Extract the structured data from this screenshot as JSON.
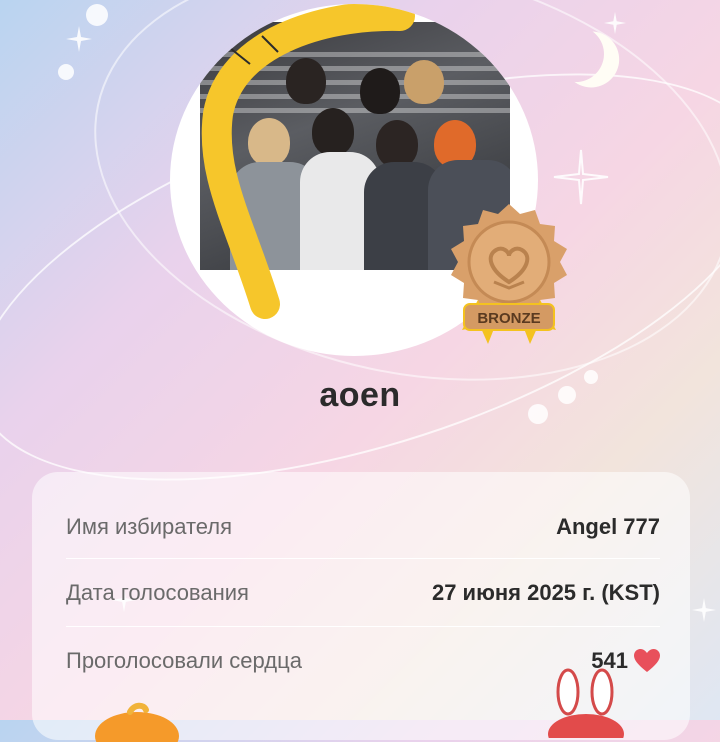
{
  "profile": {
    "username": "aoen",
    "badge_text": "BRONZE"
  },
  "details": {
    "rows": [
      {
        "label": "Имя избирателя",
        "value": "Angel 777"
      },
      {
        "label": "Дата голосования",
        "value": "27 июня 2025 г. (KST)"
      },
      {
        "label": "Проголосовали сердца",
        "value": "541"
      }
    ]
  },
  "icons": {
    "badge": "bronze-medal-icon",
    "heart": "heart-icon",
    "moon": "crescent-moon-icon",
    "sparkle": "sparkle-icon"
  },
  "colors": {
    "heart": "#e8505b",
    "bronze": "#d9a06a",
    "ribbon": "#f4c21f",
    "text_dark": "#2b2b2b",
    "text_label": "#6a6a6a"
  }
}
